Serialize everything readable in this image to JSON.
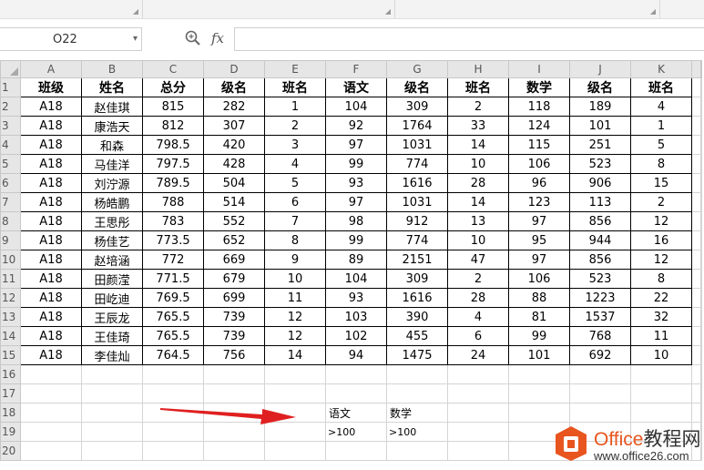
{
  "name_box": {
    "value": "O22"
  },
  "formula_bar": {
    "fx_label": "fx",
    "value": ""
  },
  "columns": [
    "A",
    "B",
    "C",
    "D",
    "E",
    "F",
    "G",
    "H",
    "I",
    "J",
    "K"
  ],
  "header_row": [
    "班级",
    "姓名",
    "总分",
    "级名",
    "班名",
    "语文",
    "级名",
    "班名",
    "数学",
    "级名",
    "班名"
  ],
  "rows": [
    [
      "A18",
      "赵佳琪",
      "815",
      "282",
      "1",
      "104",
      "309",
      "2",
      "118",
      "189",
      "4"
    ],
    [
      "A18",
      "康浩天",
      "812",
      "307",
      "2",
      "92",
      "1764",
      "33",
      "124",
      "101",
      "1"
    ],
    [
      "A18",
      "和森",
      "798.5",
      "420",
      "3",
      "97",
      "1031",
      "14",
      "115",
      "251",
      "5"
    ],
    [
      "A18",
      "马佳洋",
      "797.5",
      "428",
      "4",
      "99",
      "774",
      "10",
      "106",
      "523",
      "8"
    ],
    [
      "A18",
      "刘泞源",
      "789.5",
      "504",
      "5",
      "93",
      "1616",
      "28",
      "96",
      "906",
      "15"
    ],
    [
      "A18",
      "杨皓鹏",
      "788",
      "514",
      "6",
      "97",
      "1031",
      "14",
      "123",
      "113",
      "2"
    ],
    [
      "A18",
      "王思彤",
      "783",
      "552",
      "7",
      "98",
      "912",
      "13",
      "97",
      "856",
      "12"
    ],
    [
      "A18",
      "杨佳艺",
      "773.5",
      "652",
      "8",
      "99",
      "774",
      "10",
      "95",
      "944",
      "16"
    ],
    [
      "A18",
      "赵培涵",
      "772",
      "669",
      "9",
      "89",
      "2151",
      "47",
      "97",
      "856",
      "12"
    ],
    [
      "A18",
      "田颜滢",
      "771.5",
      "679",
      "10",
      "104",
      "309",
      "2",
      "106",
      "523",
      "8"
    ],
    [
      "A18",
      "田屹迪",
      "769.5",
      "699",
      "11",
      "93",
      "1616",
      "28",
      "88",
      "1223",
      "22"
    ],
    [
      "A18",
      "王辰龙",
      "765.5",
      "739",
      "12",
      "103",
      "390",
      "4",
      "81",
      "1537",
      "32"
    ],
    [
      "A18",
      "王佳琦",
      "765.5",
      "739",
      "12",
      "102",
      "455",
      "6",
      "99",
      "768",
      "11"
    ],
    [
      "A18",
      "李佳灿",
      "764.5",
      "756",
      "14",
      "94",
      "1475",
      "24",
      "101",
      "692",
      "10"
    ]
  ],
  "criteria": {
    "headers": [
      "语文",
      "数学"
    ],
    "values": [
      ">100",
      ">100"
    ]
  },
  "watermark": {
    "brand": "Office",
    "suffix": "教程网",
    "url": "www.office26.com"
  },
  "colors": {
    "arrow": "#e02020",
    "logo_orange": "#e8551f"
  }
}
